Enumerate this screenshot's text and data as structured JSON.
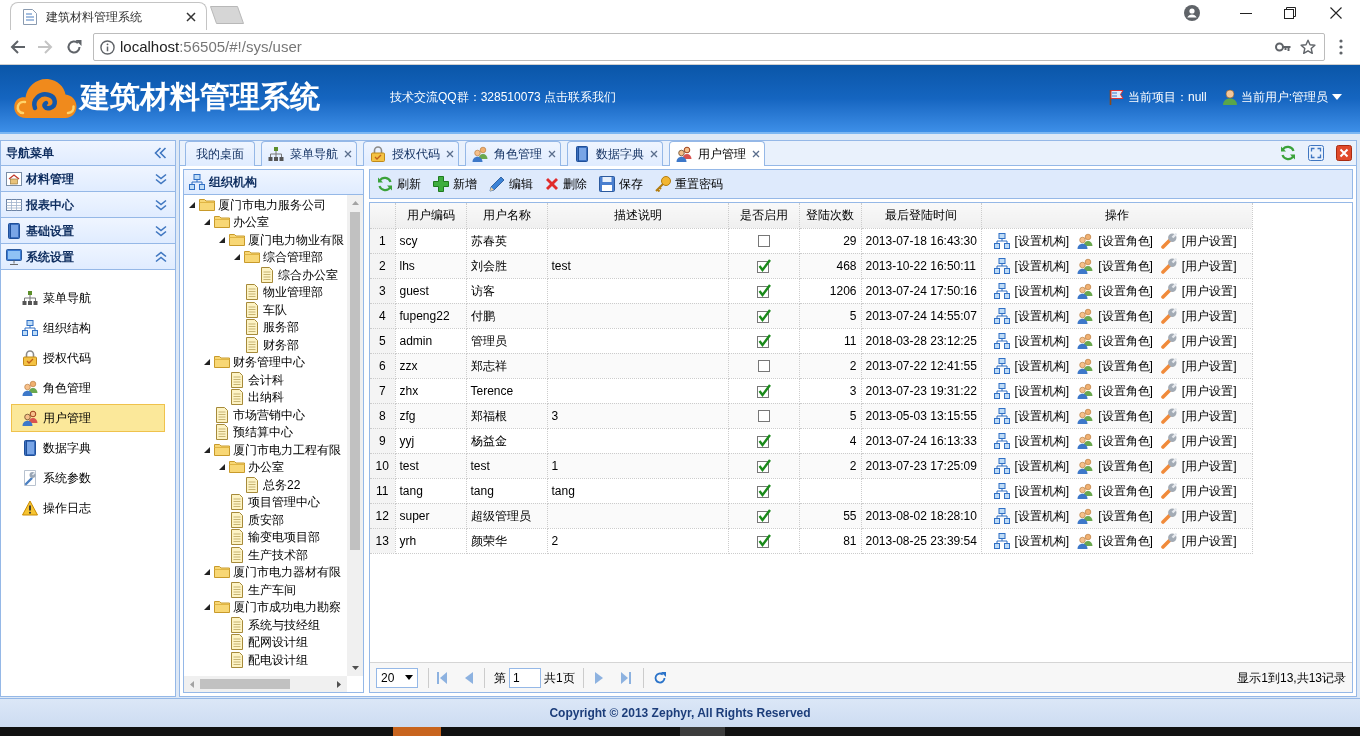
{
  "browser": {
    "tab": {
      "title": "建筑材料管理系统"
    },
    "address": {
      "host": "localhost",
      "path": ":56505/#!/sys/user"
    }
  },
  "header": {
    "title": "建筑材料管理系统",
    "notice": "技术交流QQ群：328510073 点击联系我们",
    "project": "当前项目：null",
    "user": "当前用户:管理员"
  },
  "nav": {
    "title": "导航菜单",
    "sections": [
      {
        "label": "材料管理",
        "expanded": false
      },
      {
        "label": "报表中心",
        "expanded": false
      },
      {
        "label": "基础设置",
        "expanded": false
      },
      {
        "label": "系统设置",
        "expanded": true,
        "items": [
          {
            "label": "菜单导航",
            "selected": false
          },
          {
            "label": "组织结构",
            "selected": false
          },
          {
            "label": "授权代码",
            "selected": false
          },
          {
            "label": "角色管理",
            "selected": false
          },
          {
            "label": "用户管理",
            "selected": true
          },
          {
            "label": "数据字典",
            "selected": false
          },
          {
            "label": "系统参数",
            "selected": false
          },
          {
            "label": "操作日志",
            "selected": false
          }
        ]
      }
    ]
  },
  "tabs": [
    {
      "label": "我的桌面",
      "closable": false,
      "selected": false
    },
    {
      "label": "菜单导航",
      "closable": true,
      "selected": false
    },
    {
      "label": "授权代码",
      "closable": true,
      "selected": false
    },
    {
      "label": "角色管理",
      "closable": true,
      "selected": false
    },
    {
      "label": "数据字典",
      "closable": true,
      "selected": false
    },
    {
      "label": "用户管理",
      "closable": true,
      "selected": true
    }
  ],
  "org_tree": {
    "title": "组织机构",
    "nodes": [
      {
        "label": "厦门市电力服务公司",
        "kind": "folder",
        "expanded": true,
        "children": [
          {
            "label": "办公室",
            "kind": "folder",
            "expanded": true,
            "children": [
              {
                "label": "厦门电力物业有限",
                "kind": "folder",
                "expanded": true,
                "children": [
                  {
                    "label": "综合管理部",
                    "kind": "folder",
                    "expanded": true,
                    "children": [
                      {
                        "label": "综合办公室",
                        "kind": "file"
                      }
                    ]
                  },
                  {
                    "label": "物业管理部",
                    "kind": "file"
                  },
                  {
                    "label": "车队",
                    "kind": "file"
                  },
                  {
                    "label": "服务部",
                    "kind": "file"
                  },
                  {
                    "label": "财务部",
                    "kind": "file"
                  }
                ]
              }
            ]
          },
          {
            "label": "财务管理中心",
            "kind": "folder",
            "expanded": true,
            "children": [
              {
                "label": "会计科",
                "kind": "file"
              },
              {
                "label": "出纳科",
                "kind": "file"
              }
            ]
          },
          {
            "label": "市场营销中心",
            "kind": "file"
          },
          {
            "label": "预结算中心",
            "kind": "file"
          },
          {
            "label": "厦门市电力工程有限",
            "kind": "folder",
            "expanded": true,
            "children": [
              {
                "label": "办公室",
                "kind": "folder",
                "expanded": true,
                "children": [
                  {
                    "label": "总务22",
                    "kind": "file"
                  }
                ]
              },
              {
                "label": "项目管理中心",
                "kind": "file"
              },
              {
                "label": "质安部",
                "kind": "file"
              },
              {
                "label": "输变电项目部",
                "kind": "file"
              },
              {
                "label": "生产技术部",
                "kind": "file"
              }
            ]
          },
          {
            "label": "厦门市电力器材有限",
            "kind": "folder",
            "expanded": true,
            "children": [
              {
                "label": "生产车间",
                "kind": "file"
              }
            ]
          },
          {
            "label": "厦门市成功电力勘察",
            "kind": "folder",
            "expanded": true,
            "children": [
              {
                "label": "系统与技经组",
                "kind": "file"
              },
              {
                "label": "配网设计组",
                "kind": "file"
              },
              {
                "label": "配电设计组",
                "kind": "file"
              }
            ]
          }
        ]
      }
    ]
  },
  "toolbar": [
    "刷新",
    "新增",
    "编辑",
    "删除",
    "保存",
    "重置密码"
  ],
  "table": {
    "columns": [
      "用户编码",
      "用户名称",
      "描述说明",
      "是否启用",
      "登陆次数",
      "最后登陆时间",
      "操作"
    ],
    "rows": [
      {
        "number": "1",
        "code": "scy",
        "name": "苏春英",
        "enabled": false,
        "logins": "29",
        "last_login": "2013-07-18 16:43:30",
        "actions": [
          "[设置机构]",
          "[设置角色]",
          "[用户设置]"
        ]
      },
      {
        "number": "2",
        "code": "lhs",
        "name": "刘会胜",
        "description": "test",
        "enabled": true,
        "logins": "468",
        "last_login": "2013-10-22 16:50:11",
        "actions": [
          "[设置机构]",
          "[设置角色]",
          "[用户设置]"
        ]
      },
      {
        "number": "3",
        "code": "guest",
        "name": "访客",
        "enabled": true,
        "logins": "1206",
        "last_login": "2013-07-24 17:50:16",
        "actions": [
          "[设置机构]",
          "[设置角色]",
          "[用户设置]"
        ]
      },
      {
        "number": "4",
        "code": "fupeng22",
        "name": "付鹏",
        "enabled": true,
        "logins": "5",
        "last_login": "2013-07-24 14:55:07",
        "actions": [
          "[设置机构]",
          "[设置角色]",
          "[用户设置]"
        ]
      },
      {
        "number": "5",
        "code": "admin",
        "name": "管理员",
        "enabled": true,
        "logins": "11",
        "last_login": "2018-03-28 23:12:25",
        "actions": [
          "[设置机构]",
          "[设置角色]",
          "[用户设置]"
        ]
      },
      {
        "number": "6",
        "code": "zzx",
        "name": "郑志祥",
        "enabled": false,
        "logins": "2",
        "last_login": "2013-07-22 12:41:55",
        "actions": [
          "[设置机构]",
          "[设置角色]",
          "[用户设置]"
        ]
      },
      {
        "number": "7",
        "code": "zhx",
        "name": "Terence",
        "enabled": true,
        "logins": "3",
        "last_login": "2013-07-23 19:31:22",
        "actions": [
          "[设置机构]",
          "[设置角色]",
          "[用户设置]"
        ]
      },
      {
        "number": "8",
        "code": "zfg",
        "name": "郑福根",
        "description": "3",
        "enabled": false,
        "logins": "5",
        "last_login": "2013-05-03 13:15:55",
        "actions": [
          "[设置机构]",
          "[设置角色]",
          "[用户设置]"
        ]
      },
      {
        "number": "9",
        "code": "yyj",
        "name": "杨益金",
        "enabled": true,
        "logins": "4",
        "last_login": "2013-07-24 16:13:33",
        "actions": [
          "[设置机构]",
          "[设置角色]",
          "[用户设置]"
        ]
      },
      {
        "number": "10",
        "code": "test",
        "name": "test",
        "description": "1",
        "enabled": true,
        "logins": "2",
        "last_login": "2013-07-23 17:25:09",
        "actions": [
          "[设置机构]",
          "[设置角色]",
          "[用户设置]"
        ]
      },
      {
        "number": "11",
        "code": "tang",
        "name": "tang",
        "description": "tang",
        "enabled": true,
        "actions": [
          "[设置机构]",
          "[设置角色]",
          "[用户设置]"
        ]
      },
      {
        "number": "12",
        "code": "super",
        "name": "超级管理员",
        "enabled": true,
        "logins": "55",
        "last_login": "2013-08-02 18:28:10",
        "actions": [
          "[设置机构]",
          "[设置角色]",
          "[用户设置]"
        ]
      },
      {
        "number": "13",
        "code": "yrh",
        "name": "颜荣华",
        "description": "2",
        "enabled": true,
        "logins": "81",
        "last_login": "2013-08-25 23:39:54",
        "actions": [
          "[设置机构]",
          "[设置角色]",
          "[用户设置]"
        ]
      }
    ]
  },
  "pager": {
    "page_size": "20",
    "page_label": "第",
    "page": "1",
    "total_pages": "共1页",
    "summary": "显示1到13,共13记录"
  },
  "footer": "Copyright © 2013 Zephyr, All Rights Reserved"
}
